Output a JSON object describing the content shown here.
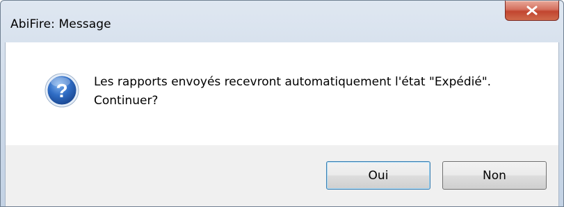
{
  "window": {
    "title": "AbiFire: Message"
  },
  "dialog": {
    "icon": "question-icon",
    "message_line1": "Les rapports envoyés recevront automatiquement l'état \"Expédié\".",
    "message_line2": "Continuer?"
  },
  "buttons": {
    "yes_label": "Oui",
    "no_label": "Non"
  },
  "colors": {
    "icon_blue": "#2a63b8",
    "close_red": "#c2452f",
    "default_button_border": "#3c7fb1"
  }
}
